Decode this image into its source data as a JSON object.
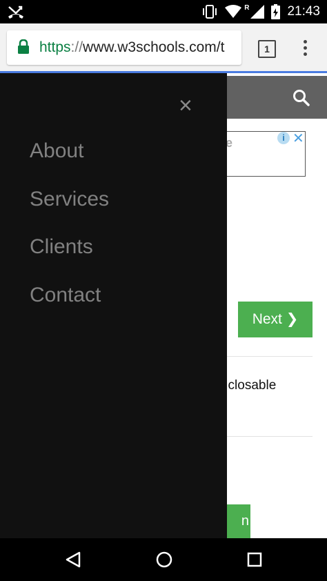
{
  "status_bar": {
    "time": "21:43",
    "icons": [
      "missed-call-icon",
      "vibrate-icon",
      "wifi-icon",
      "roaming-indicator",
      "signal-icon",
      "battery-icon"
    ],
    "roaming_label": "R"
  },
  "browser": {
    "url_scheme": "https",
    "url_separator": "://",
    "url_host": "www.w3schools.com/t",
    "tab_count": "1"
  },
  "drawer": {
    "close_label": "×",
    "items": [
      {
        "label": "About"
      },
      {
        "label": "Services"
      },
      {
        "label": "Clients"
      },
      {
        "label": "Contact"
      }
    ]
  },
  "page": {
    "ad_partial_text": "e",
    "ad_info_label": "i",
    "ad_close_label": "✕",
    "next_button_label": "Next ❯",
    "partial_text": ", closable",
    "partial_button_label": "n"
  },
  "colors": {
    "drawer_bg": "#111111",
    "drawer_text": "#818181",
    "topnav_bg": "#616161",
    "accent_green": "#4caf50",
    "progress_blue": "#4a7be0",
    "lock_green": "#0b8043"
  }
}
